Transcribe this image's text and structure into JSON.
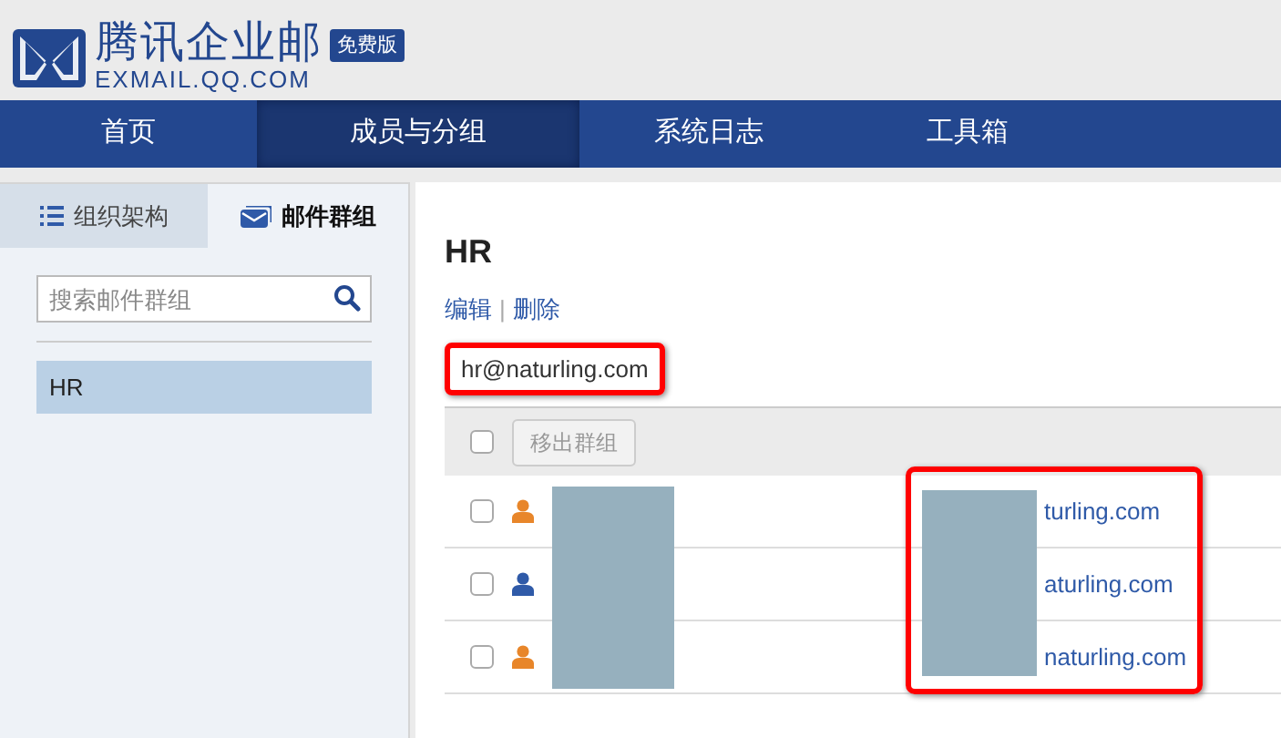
{
  "header": {
    "logo_title": "腾讯企业邮",
    "logo_badge": "免费版",
    "logo_subtitle": "EXMAIL.QQ.COM"
  },
  "nav": [
    {
      "label": "首页",
      "selected": false
    },
    {
      "label": "成员与分组",
      "selected": true
    },
    {
      "label": "系统日志",
      "selected": false
    },
    {
      "label": "工具箱",
      "selected": false
    }
  ],
  "sidebar": {
    "tabs": [
      {
        "label": "组织架构",
        "kind": "list",
        "selected": false
      },
      {
        "label": "邮件群组",
        "kind": "mail",
        "selected": true
      }
    ],
    "search": {
      "placeholder": "搜索邮件群组"
    },
    "groups": [
      {
        "label": "HR",
        "selected": true
      }
    ]
  },
  "main": {
    "title": "HR",
    "actions": [
      "编辑",
      "删除"
    ],
    "action_separator": "|",
    "group_email": "hr@naturling.com",
    "toolbar": {
      "checked": false,
      "remove_button": "移出群组",
      "disabled": true
    },
    "members": [
      {
        "color": "#e8862a",
        "checked": false,
        "email": "turling.com"
      },
      {
        "color": "#2f5aa8",
        "checked": false,
        "email": "aturling.com"
      },
      {
        "color": "#e8862a",
        "checked": false,
        "email": "naturling.com"
      }
    ]
  }
}
